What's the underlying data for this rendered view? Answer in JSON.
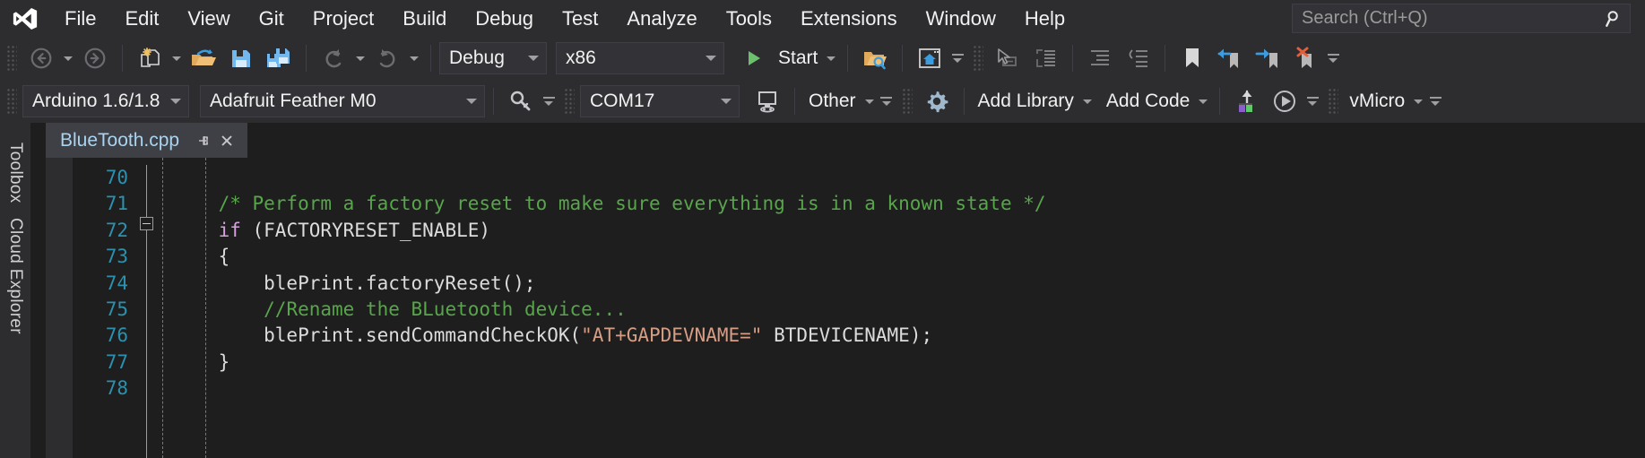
{
  "window": {
    "app_logo": "visual-studio-logo",
    "accent_blue": "#0078d4",
    "bg": "#1e1e1e",
    "chrome_bg": "#2d2d30"
  },
  "menubar": {
    "items": [
      {
        "label": "File"
      },
      {
        "label": "Edit"
      },
      {
        "label": "View"
      },
      {
        "label": "Git"
      },
      {
        "label": "Project"
      },
      {
        "label": "Build"
      },
      {
        "label": "Debug"
      },
      {
        "label": "Test"
      },
      {
        "label": "Analyze"
      },
      {
        "label": "Tools"
      },
      {
        "label": "Extensions"
      },
      {
        "label": "Window"
      },
      {
        "label": "Help"
      }
    ],
    "search": {
      "placeholder": "Search (Ctrl+Q)",
      "value": "",
      "icon": "magnifier-icon"
    }
  },
  "toolbar_standard": {
    "back_icon": "navigate-back-icon",
    "forward_icon": "navigate-forward-icon",
    "new_item_icon": "new-item-icon",
    "open_file_icon": "open-file-icon",
    "save_icon": "save-icon",
    "save_all_icon": "save-all-icon",
    "undo_icon": "undo-icon",
    "redo_icon": "redo-icon",
    "config_value": "Debug",
    "platform_value": "x86",
    "start_label": "Start",
    "start_icon": "play-icon",
    "find_in_folder_icon": "find-in-folder-icon",
    "home_window_icon": "home-window-icon",
    "select_tool_icon": "pointer-select-icon",
    "attach_panel_icon": "attach-panel-icon",
    "indent_icon": "increase-indent-icon",
    "outdent_icon": "decrease-indent-icon",
    "bookmark_icon": "bookmark-icon",
    "prev_bookmark_icon": "previous-bookmark-icon",
    "next_bookmark_icon": "next-bookmark-icon",
    "clear_bookmarks_icon": "clear-bookmarks-icon",
    "overflow_icon": "toolbar-overflow-icon"
  },
  "toolbar_vmicro": {
    "ide_version_value": "Arduino 1.6/1.8",
    "board_value": "Adafruit Feather M0",
    "programmer_icon": "debugger-key-icon",
    "port_value": "COM17",
    "serial_monitor_icon": "serial-monitor-icon",
    "other_label": "Other",
    "settings_icon": "gear-icon",
    "add_library_label": "Add Library",
    "add_code_label": "Add Code",
    "upload_icon": "upload-sketch-icon",
    "compile_icon": "build-run-icon",
    "vmicro_label": "vMicro",
    "overflow_icon": "toolbar-overflow-icon"
  },
  "left_dock": {
    "tabs": [
      {
        "label": "Toolbox"
      },
      {
        "label": "Cloud Explorer"
      }
    ]
  },
  "document": {
    "tab": {
      "title": "BlueTooth.cpp",
      "pin_icon": "pin-icon",
      "close_icon": "close-icon"
    },
    "editor": {
      "first_line_number": 70,
      "line_numbers": [
        70,
        71,
        72,
        73,
        74,
        75,
        76,
        77,
        78
      ],
      "fold_marker_line": 72,
      "lines": [
        {
          "n": 70,
          "segments": []
        },
        {
          "n": 71,
          "segments": [
            {
              "t": "    ",
              "c": "pl"
            },
            {
              "t": "/* Perform a factory reset to make sure everything is in a known state */",
              "c": "cm"
            }
          ]
        },
        {
          "n": 72,
          "segments": [
            {
              "t": "    ",
              "c": "pl"
            },
            {
              "t": "if",
              "c": "kw"
            },
            {
              "t": " (FACTORYRESET_ENABLE)",
              "c": "pl"
            }
          ]
        },
        {
          "n": 73,
          "segments": [
            {
              "t": "    {",
              "c": "pl"
            }
          ]
        },
        {
          "n": 74,
          "segments": [
            {
              "t": "        blePrint.factoryReset();",
              "c": "pl"
            }
          ]
        },
        {
          "n": 75,
          "segments": [
            {
              "t": "        ",
              "c": "pl"
            },
            {
              "t": "//Rename the BLuetooth device...",
              "c": "cm"
            }
          ]
        },
        {
          "n": 76,
          "segments": [
            {
              "t": "        blePrint.sendCommandCheckOK(",
              "c": "pl"
            },
            {
              "t": "\"AT+GAPDEVNAME=\"",
              "c": "str"
            },
            {
              "t": " BTDEVICENAME);",
              "c": "pl"
            }
          ]
        },
        {
          "n": 77,
          "segments": [
            {
              "t": "    }",
              "c": "pl"
            }
          ]
        },
        {
          "n": 78,
          "segments": []
        }
      ]
    }
  }
}
